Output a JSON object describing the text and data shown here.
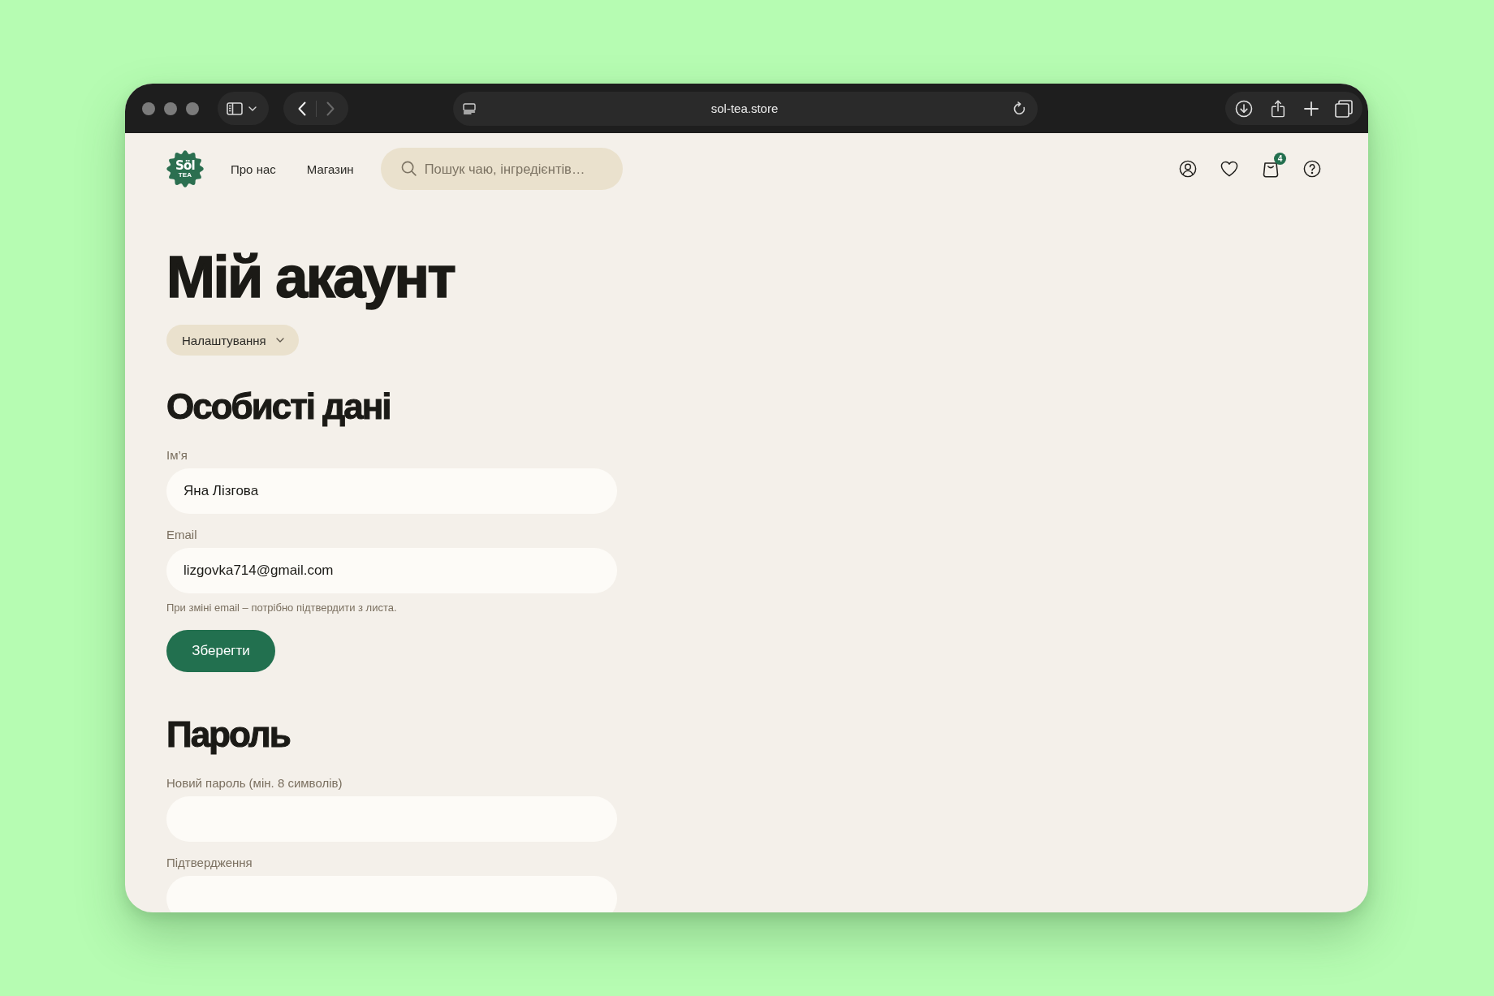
{
  "browser": {
    "nav_buttons": [
      {
        "kind": "back",
        "disabled": false
      },
      {
        "kind": "forward",
        "disabled": true
      }
    ],
    "url": "sol-tea.store"
  },
  "header": {
    "logo": {
      "wordmark": "Söl",
      "tagline": "TEA"
    },
    "nav": [
      {
        "label": "Про нас"
      },
      {
        "label": "Магазин"
      }
    ],
    "search": {
      "placeholder": "Пошук чаю, інгредієнтів…"
    },
    "cart_count": "4"
  },
  "page": {
    "title": "Мій акаунт",
    "section_dropdown": {
      "label": "Налаштування"
    },
    "sections": [
      {
        "title": "Особисті дані",
        "fields": [
          {
            "label": "Ім’я",
            "value": "Яна Лізгова"
          },
          {
            "label": "Email",
            "value": "lizgovka714@gmail.com",
            "hint": "При зміні email – потрібно підтвердити з листа."
          }
        ],
        "button": "Зберегти"
      },
      {
        "title": "Пароль",
        "fields": [
          {
            "label": "Новий пароль (мін. 8 символів)"
          },
          {
            "label": "Підтвердження"
          }
        ]
      }
    ]
  }
}
